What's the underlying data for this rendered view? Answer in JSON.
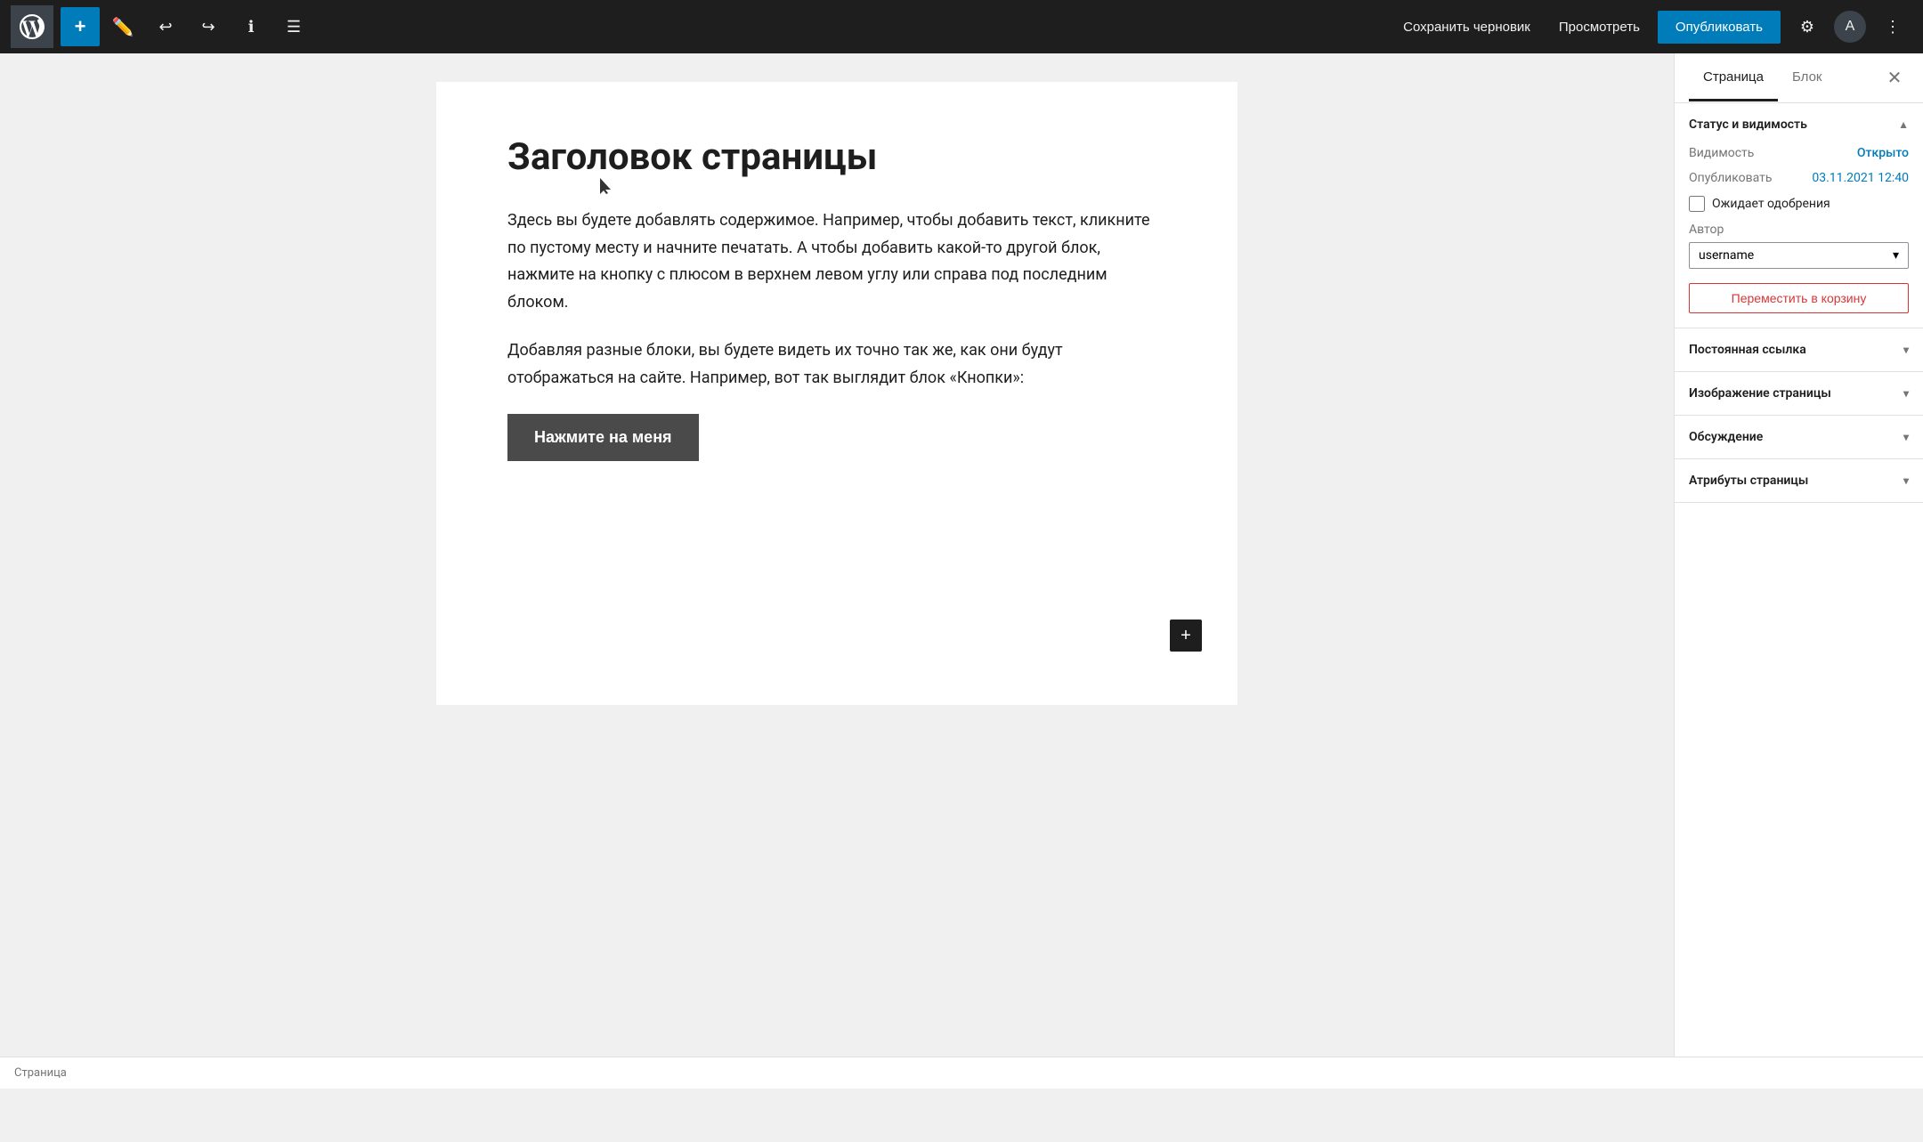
{
  "toolbar": {
    "add_label": "+",
    "save_draft_label": "Сохранить черновик",
    "preview_label": "Просмотреть",
    "publish_label": "Опубликовать"
  },
  "editor": {
    "page_title": "Заголовок страницы",
    "paragraph1": "Здесь вы будете добавлять содержимое. Например, чтобы добавить текст, кликните по пустому месту и начните печатать. А чтобы добавить какой-то другой блок, нажмите на кнопку с плюсом в верхнем левом углу или справа под последним блоком.",
    "paragraph2": "Добавляя разные блоки, вы будете видеть их точно так же, как они будут отображаться на сайте. Например, вот так выглядит блок «Кнопки»:",
    "button_label": "Нажмите на меня",
    "add_block_icon": "+"
  },
  "sidebar": {
    "tab_page": "Страница",
    "tab_block": "Блок",
    "section_status": {
      "title": "Статус и видимость",
      "visibility_label": "Видимость",
      "visibility_value": "Открыто",
      "publish_label": "Опубликовать",
      "publish_value": "03.11.2021 12:40",
      "pending_label": "Ожидает одобрения",
      "author_label": "Автор",
      "author_value": "username",
      "trash_label": "Переместить в корзину"
    },
    "section_permalink": {
      "title": "Постоянная ссылка"
    },
    "section_featured_image": {
      "title": "Изображение страницы"
    },
    "section_discussion": {
      "title": "Обсуждение"
    },
    "section_page_attributes": {
      "title": "Атрибуты страницы"
    }
  },
  "status_bar": {
    "breadcrumb": "Страница"
  }
}
